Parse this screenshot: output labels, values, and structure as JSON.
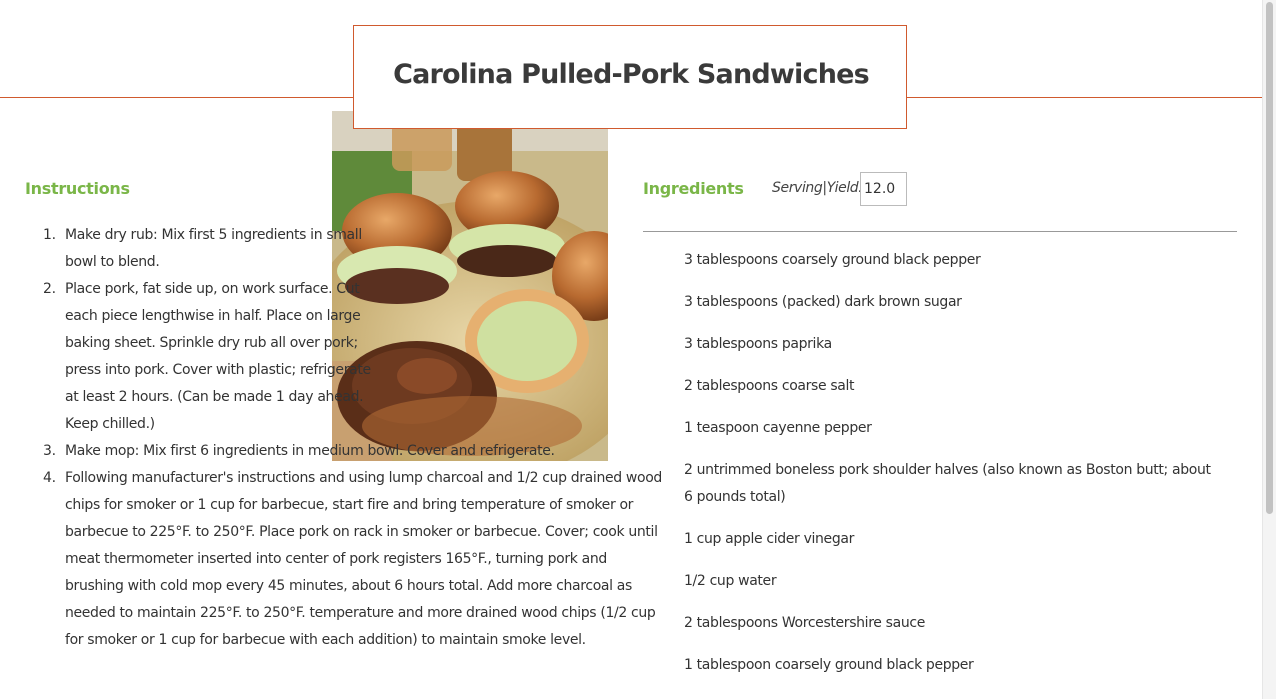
{
  "recipe": {
    "title": "Carolina Pulled-Pork Sandwiches"
  },
  "photo": {
    "alt": "Pulled-pork sandwiches with coleslaw on buns"
  },
  "instructions": {
    "heading": "Instructions",
    "steps": [
      "Make dry rub: Mix first 5 ingredients in small bowl to blend.",
      "Place pork, fat side up, on work surface. Cut each piece lengthwise in half. Place on large baking sheet. Sprinkle dry rub all over pork; press into pork. Cover with plastic; refrigerate at least 2 hours. (Can be made 1 day ahead. Keep chilled.)",
      "Make mop: Mix first 6 ingredients in medium bowl. Cover and refrigerate.",
      "Following manufacturer's instructions and using lump charcoal and 1/2 cup drained wood chips for smoker or 1 cup for barbecue, start fire and bring temperature of smoker or barbecue to 225°F. to 250°F. Place pork on rack in smoker or barbecue. Cover; cook until meat thermometer inserted into center of pork registers 165°F., turning pork and brushing with cold mop every 45 minutes, about 6 hours total. Add more charcoal as needed to maintain 225°F. to 250°F. temperature and more drained wood chips (1/2 cup for smoker or 1 cup for barbecue with each addition) to maintain smoke level."
    ]
  },
  "ingredients": {
    "heading": "Ingredients",
    "serving_label": "Serving|Yield:",
    "serving_value": "12.0",
    "items": [
      "3 tablespoons coarsely ground black pepper",
      "3 tablespoons (packed) dark brown sugar",
      "3 tablespoons paprika",
      "2 tablespoons coarse salt",
      "1 teaspoon cayenne pepper",
      "2 untrimmed boneless pork shoulder halves (also known as Boston butt; about 6 pounds total)",
      "1 cup apple cider vinegar",
      "1/2 cup water",
      "2 tablespoons Worcestershire sauce",
      "1 tablespoon coarsely ground black pepper"
    ]
  },
  "colors": {
    "accent_orange": "#d05a2e",
    "heading_green": "#7ab648",
    "title_text": "#3a3a3a"
  }
}
